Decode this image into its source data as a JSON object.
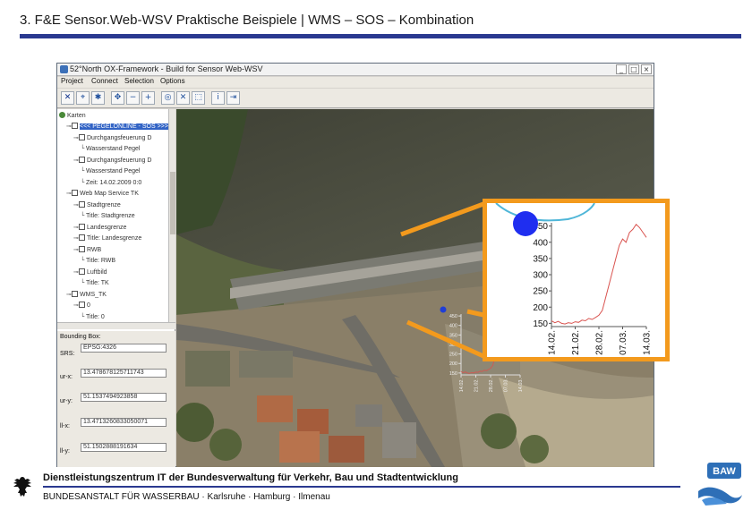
{
  "slide": {
    "title": "3. F&E Sensor.Web-WSV Praktische Beispiele | WMS – SOS  – Kombination",
    "footer_main": "Dienstleistungszentrum IT der Bundesverwaltung für Verkehr, Bau und Stadtentwicklung",
    "footer_sub": "BUNDESANSTALT FÜR WASSERBAU · Karlsruhe · Hamburg · Ilmenau",
    "logo_text": "BAW",
    "accent_color": "#2a3990",
    "callout_color": "#f39a1d"
  },
  "window": {
    "title": "52°North OX-Framework - Build for Sensor Web-WSV",
    "menu": [
      "Project",
      "Connect",
      "Selection",
      "Options"
    ],
    "toolbar_icons": [
      "remove-icon",
      "zoom-extent-icon",
      "settings-icon",
      "pan-icon",
      "zoom-out-icon",
      "zoom-in-icon",
      "reset-icon",
      "close-icon",
      "select-icon",
      "info-icon",
      "export-icon"
    ]
  },
  "tree": {
    "root": "Karten",
    "items": [
      {
        "label": "<<< PEGELONLINE - SOS >>>",
        "level": 1,
        "selected": true
      },
      {
        "label": "Durchgangsfeuerung D",
        "level": 2
      },
      {
        "label": "Wasserstand Pegel",
        "level": 3
      },
      {
        "label": "Durchgangsfeuerung D",
        "level": 2
      },
      {
        "label": "Wasserstand Pegel",
        "level": 3
      },
      {
        "label": "Zeit: 14.02.2009 0:0",
        "level": 3
      },
      {
        "label": "Web Map Service TK",
        "level": 1
      },
      {
        "label": "Stadtgrenze",
        "level": 2
      },
      {
        "label": "Title: Stadtgrenze",
        "level": 3
      },
      {
        "label": "Landesgrenze",
        "level": 2
      },
      {
        "label": "Title: Landesgrenze",
        "level": 2
      },
      {
        "label": "RWB",
        "level": 2
      },
      {
        "label": "Title: RWB",
        "level": 3
      },
      {
        "label": "Luftbild",
        "level": 2
      },
      {
        "label": "Title: TK",
        "level": 3
      },
      {
        "label": "WMS_TK",
        "level": 1
      },
      {
        "label": "0",
        "level": 2
      },
      {
        "label": "Title: 0",
        "level": 3
      }
    ]
  },
  "bounding_box": {
    "header": "Bounding Box:",
    "srs_label": "SRS:",
    "srs_value": "EPSG:4326",
    "ur_x_label": "ur-x:",
    "ur_x_value": "13.478678125711743",
    "ur_y_label": "ur-y:",
    "ur_y_value": "51.1537494923858",
    "ll_x_label": "ll-x:",
    "ll_x_value": "13.4713260833050071",
    "ll_y_label": "ll-y:",
    "ll_y_value": "51.1502888191634"
  },
  "chart_data": [
    {
      "type": "line",
      "title": "",
      "xlabel": "",
      "ylabel": "",
      "x_tick_labels": [
        "14.02.",
        "21.02.",
        "28.02.",
        "07.03.",
        "14.03."
      ],
      "y_tick_labels": [
        "150",
        "200",
        "250",
        "300",
        "350",
        "400",
        "450"
      ],
      "ylim": [
        140,
        460
      ],
      "grid": false,
      "line_color": "#d9534f",
      "series": [
        {
          "x": [
            "14.02.",
            "15.02.",
            "16.02.",
            "17.02.",
            "18.02.",
            "19.02.",
            "20.02.",
            "21.02.",
            "22.02.",
            "23.02.",
            "24.02.",
            "25.02.",
            "26.02.",
            "27.02.",
            "28.02.",
            "01.03.",
            "02.03.",
            "03.03.",
            "04.03.",
            "05.03.",
            "06.03.",
            "07.03.",
            "08.03.",
            "09.03.",
            "10.03.",
            "11.03.",
            "12.03.",
            "13.03.",
            "14.03."
          ],
          "values": [
            158,
            152,
            156,
            150,
            148,
            152,
            150,
            155,
            153,
            160,
            158,
            165,
            162,
            168,
            175,
            190,
            230,
            270,
            310,
            350,
            390,
            410,
            400,
            430,
            440,
            455,
            445,
            430,
            415
          ]
        }
      ]
    }
  ]
}
